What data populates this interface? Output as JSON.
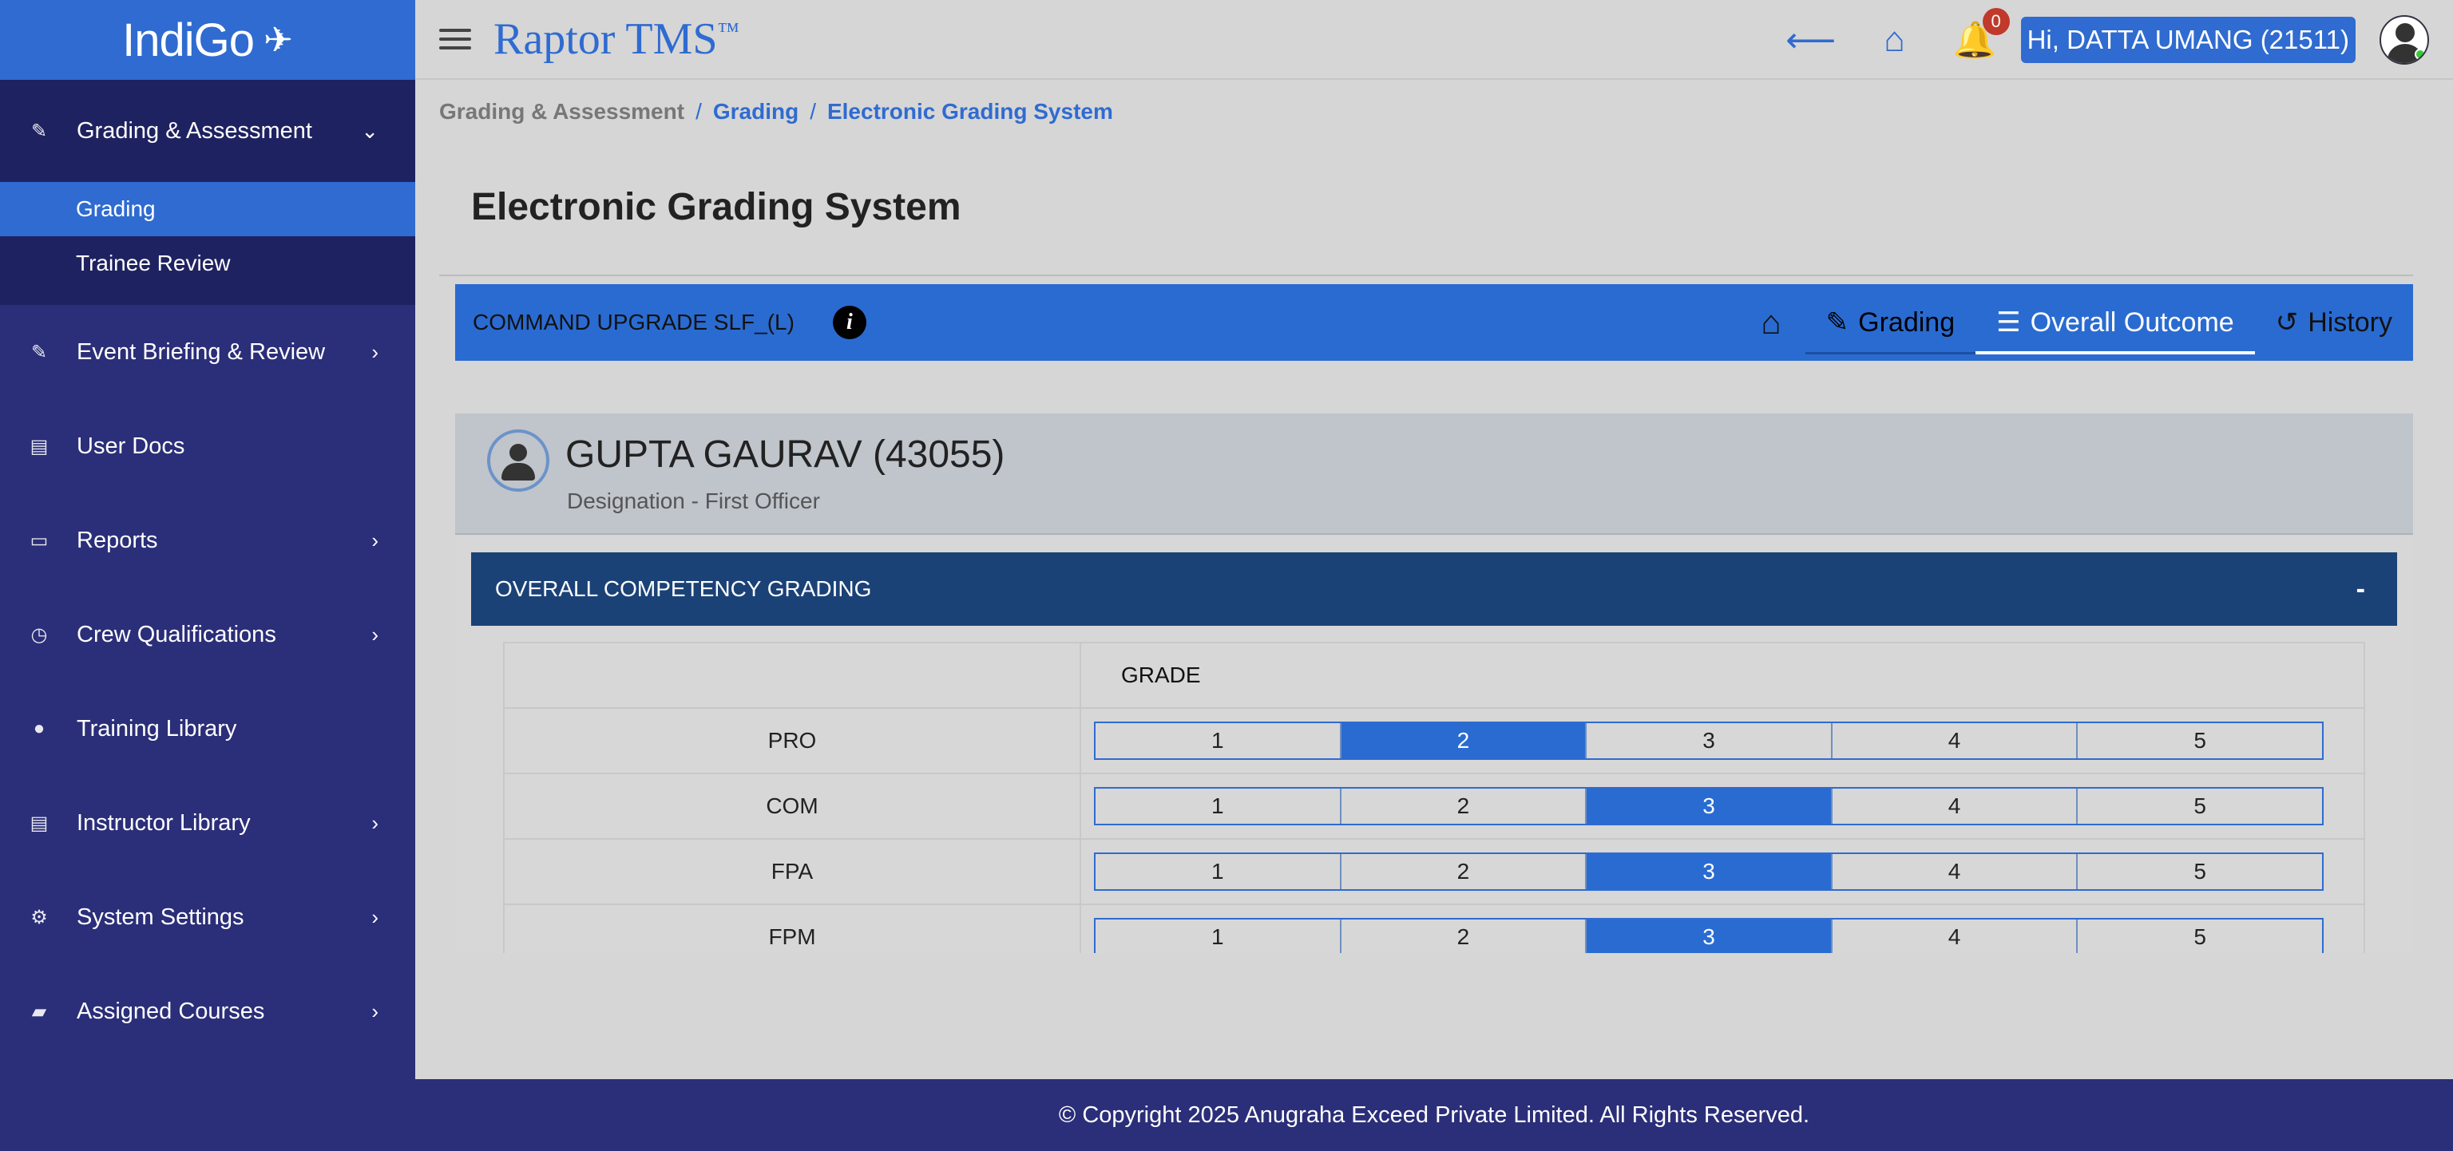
{
  "logo": {
    "text": "IndiGo",
    "mark": "plane-dots-icon"
  },
  "sidebar": {
    "items": [
      {
        "label": "Grading & Assessment",
        "icon": "edit-icon",
        "expanded": true,
        "children": [
          {
            "label": "Grading",
            "active": true
          },
          {
            "label": "Trainee Review",
            "active": false
          }
        ]
      },
      {
        "label": "Event Briefing & Review",
        "icon": "edit-icon"
      },
      {
        "label": "User Docs",
        "icon": "document-icon"
      },
      {
        "label": "Reports",
        "icon": "report-icon"
      },
      {
        "label": "Crew Qualifications",
        "icon": "clock-icon"
      },
      {
        "label": "Training Library",
        "icon": "user-icon"
      },
      {
        "label": "Instructor Library",
        "icon": "document-icon"
      },
      {
        "label": "System Settings",
        "icon": "gears-icon"
      },
      {
        "label": "Assigned Courses",
        "icon": "folder-open-icon"
      }
    ]
  },
  "header": {
    "brand": "Raptor TMS",
    "brand_tm": "™",
    "notification_count": "0",
    "user_greeting": "Hi, DATTA UMANG (21511)"
  },
  "breadcrumb": {
    "root": "Grading & Assessment",
    "level2": "Grading",
    "current": "Electronic Grading System"
  },
  "page": {
    "title": "Electronic Grading System"
  },
  "course_bar": {
    "course": "COMMAND UPGRADE SLF_(L)",
    "tabs": [
      {
        "label": "Grading",
        "icon": "edit-icon"
      },
      {
        "label": "Overall Outcome",
        "icon": "list-icon",
        "active": true
      },
      {
        "label": "History",
        "icon": "history-icon"
      }
    ]
  },
  "trainee": {
    "name": "GUPTA GAURAV (43055)",
    "designation": "Designation - First Officer"
  },
  "competency": {
    "title": "OVERALL COMPETENCY GRADING",
    "collapse_label": "-",
    "grade_header": "GRADE",
    "scale": [
      "1",
      "2",
      "3",
      "4",
      "5"
    ],
    "rows": [
      {
        "code": "PRO",
        "grade": 2
      },
      {
        "code": "COM",
        "grade": 3
      },
      {
        "code": "FPA",
        "grade": 3
      },
      {
        "code": "FPM",
        "grade": 3
      }
    ]
  },
  "footer": {
    "text": "© Copyright 2025 Anugraha Exceed Private Limited.  All Rights Reserved."
  },
  "colors": {
    "primary": "#2a6bd1",
    "sidebar": "#2b2e78",
    "section_header": "#1b4277"
  }
}
